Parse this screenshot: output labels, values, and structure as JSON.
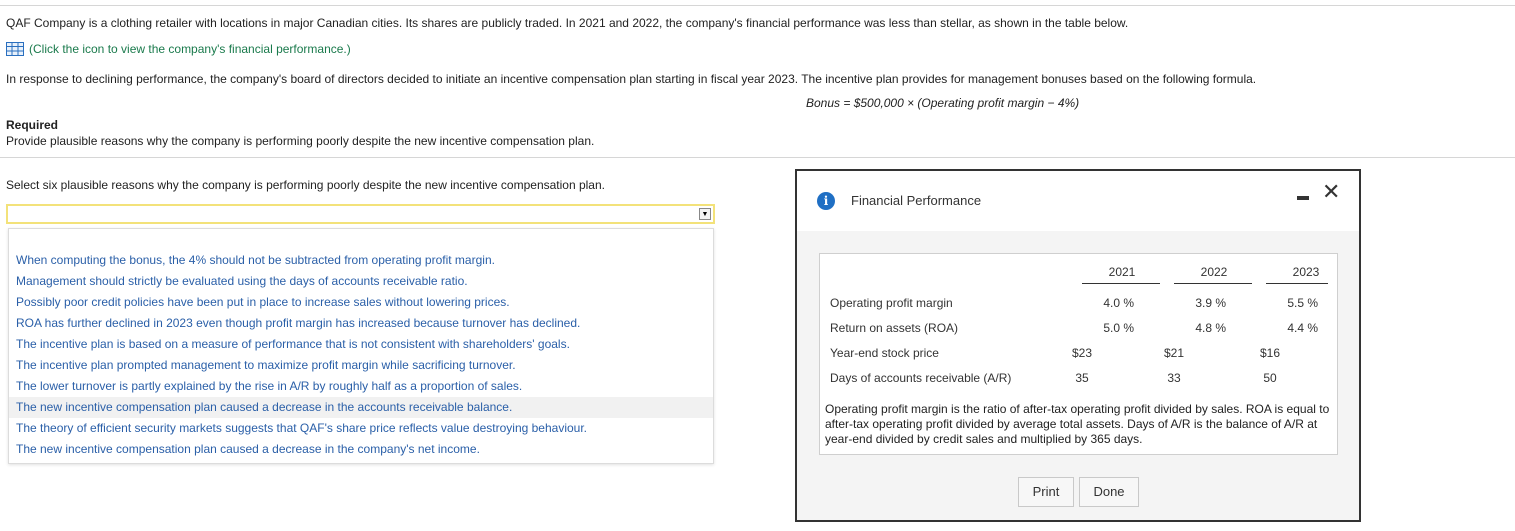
{
  "question": {
    "intro": "QAF Company is a clothing retailer with locations in major Canadian cities. Its shares are publicly traded. In 2021 and 2022, the company's financial performance was less than stellar, as shown in the table below.",
    "icon_link": "(Click the icon to view the company's financial performance.)",
    "response": "In response to declining performance, the company's board of directors decided to initiate an incentive compensation plan starting in fiscal year 2023. The incentive plan provides for management bonuses based on the following formula.",
    "formula": "Bonus = $500,000 × (Operating profit margin − 4%)",
    "required_heading": "Required",
    "required_text": "Provide plausible reasons why the company is performing poorly despite the new incentive compensation plan.",
    "select_prompt": "Select six plausible reasons why the company is performing poorly despite the new incentive compensation plan."
  },
  "dropdown": {
    "selected": "",
    "options": [
      "When computing the bonus, the 4% should not be subtracted from operating profit margin.",
      "Management should strictly be evaluated using the days of accounts receivable ratio.",
      "Possibly poor credit policies have been put in place to increase sales without lowering prices.",
      "ROA has further declined in 2023 even though profit margin has increased because turnover has declined.",
      "The incentive plan is based on a measure of performance that is not consistent with shareholders' goals.",
      "The incentive plan prompted management to maximize profit margin while sacrificing turnover.",
      "The lower turnover is partly explained by the rise in A/R by roughly half as a proportion of sales.",
      "The new incentive compensation plan caused a decrease in the accounts receivable balance.",
      "The theory of efficient security markets suggests that QAF's share price reflects value destroying behaviour.",
      "The new incentive compensation plan caused a decrease in the company's net income."
    ],
    "highlighted_index": 7
  },
  "modal": {
    "title": "Financial Performance",
    "years": [
      "2021",
      "2022",
      "2023"
    ],
    "rows": [
      {
        "label": "Operating profit margin",
        "values": [
          "4.0 %",
          "3.9 %",
          "5.5 %"
        ]
      },
      {
        "label": "Return on assets (ROA)",
        "values": [
          "5.0 %",
          "4.8 %",
          "4.4 %"
        ]
      },
      {
        "label": "Year-end stock price",
        "values": [
          "$23",
          "$21",
          "$16"
        ]
      },
      {
        "label": "Days of accounts receivable (A/R)",
        "values": [
          "35",
          "33",
          "50"
        ]
      }
    ],
    "note": "Operating profit margin is the ratio of after-tax operating profit divided by sales. ROA is equal to after-tax operating profit divided by average total assets. Days of A/R is the balance of A/R at year-end divided by credit sales and multiplied by 365 days.",
    "print_label": "Print",
    "done_label": "Done"
  }
}
